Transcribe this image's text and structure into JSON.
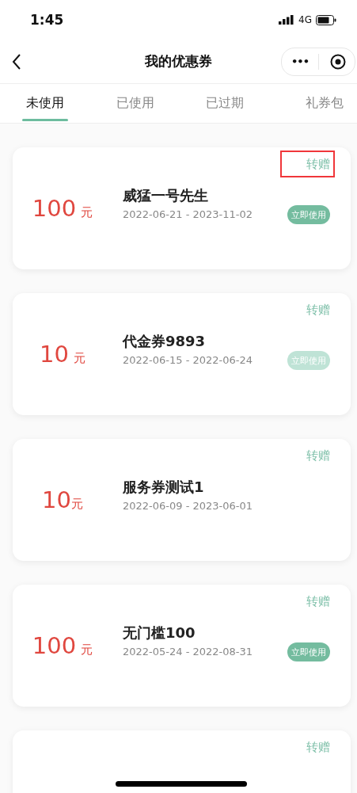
{
  "status_bar": {
    "time": "1:45",
    "network": "4G"
  },
  "nav": {
    "title": "我的优惠券",
    "more": "•••"
  },
  "tabs": [
    {
      "label": "未使用",
      "selected": true
    },
    {
      "label": "已使用",
      "selected": false
    },
    {
      "label": "已过期",
      "selected": false
    },
    {
      "label": "礼券包",
      "selected": false
    }
  ],
  "coupons": [
    {
      "amount": "100",
      "unit": "元",
      "unit_gap": true,
      "name": "威猛一号先生",
      "dates": "2022-06-21 - 2023-11-02",
      "transfer": {
        "label": "转赠",
        "highlighted": true
      },
      "button": {
        "label": "立即使用",
        "disabled": false
      }
    },
    {
      "amount": "10",
      "unit": "元",
      "unit_gap": true,
      "name": "代金券9893",
      "dates": "2022-06-15 - 2022-06-24",
      "transfer": {
        "label": "转赠",
        "highlighted": false
      },
      "button": {
        "label": "立即使用",
        "disabled": true
      }
    },
    {
      "amount": "10",
      "unit": "元",
      "unit_gap": false,
      "name": "服务券测试1",
      "dates": "2022-06-09 - 2023-06-01",
      "transfer": {
        "label": "转赠",
        "highlighted": false
      }
    },
    {
      "amount": "100",
      "unit": "元",
      "unit_gap": true,
      "name": "无门槛100",
      "dates": "2022-05-24 - 2022-08-31",
      "transfer": {
        "label": "转赠",
        "highlighted": false
      },
      "button": {
        "label": "立即使用",
        "disabled": false
      }
    },
    {
      "transfer": {
        "label": "转赠",
        "highlighted": false
      }
    }
  ]
}
